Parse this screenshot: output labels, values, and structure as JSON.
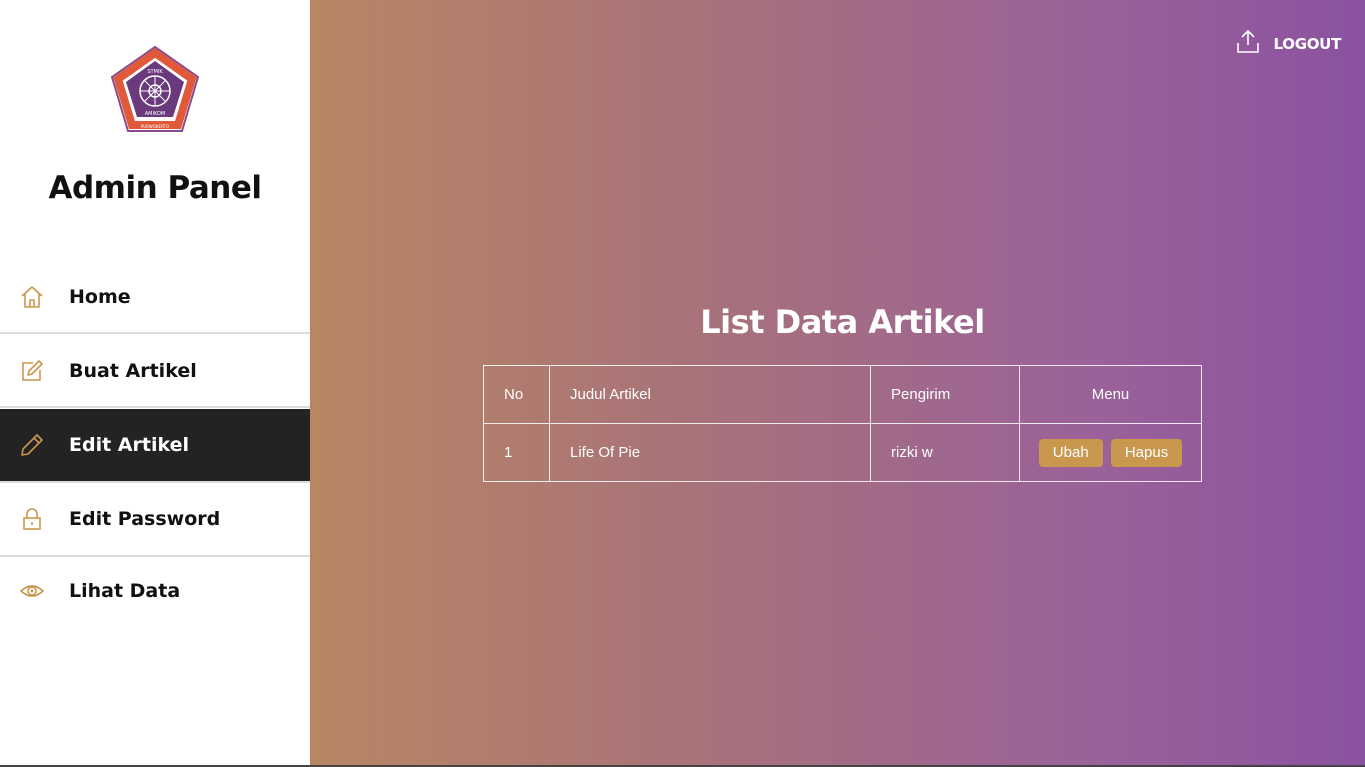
{
  "sidebar": {
    "logo": {
      "top_text": "STMIK",
      "ring_text": "MANAJEMEN INFORMATIKA DAN KOMPUTER",
      "bottom_text": "AMIKOM",
      "city": "PURWOKERTO"
    },
    "title": "Admin Panel",
    "items": [
      {
        "label": "Home",
        "icon": "home-icon"
      },
      {
        "label": "Buat Artikel",
        "icon": "edit-square-icon"
      },
      {
        "label": "Edit Artikel",
        "icon": "pencil-icon",
        "active": true
      },
      {
        "label": "Edit Password",
        "icon": "lock-icon"
      },
      {
        "label": "Lihat Data",
        "icon": "eye-icon"
      }
    ]
  },
  "header": {
    "logout_label": "LOGOUT",
    "logout_icon": "upload-icon"
  },
  "main": {
    "title": "List Data Artikel",
    "table": {
      "columns": [
        "No",
        "Judul Artikel",
        "Pengirim",
        "Menu"
      ],
      "rows": [
        {
          "no": "1",
          "judul": "Life Of Pie",
          "pengirim": "rizki w",
          "edit_label": "Ubah",
          "delete_label": "Hapus"
        }
      ]
    }
  },
  "colors": {
    "accent": "#c9974e",
    "active_nav": "#232323",
    "gradient_start": "#b98664",
    "gradient_end": "#8b52a0"
  }
}
